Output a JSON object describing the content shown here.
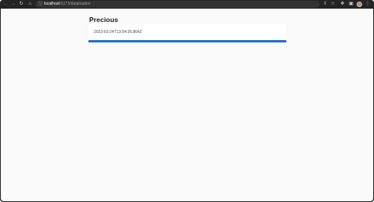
{
  "browser": {
    "url_host": "localhost",
    "url_path": ":5173/dataloader/",
    "icons": {
      "back": "arrow-left-icon",
      "forward": "arrow-right-icon",
      "reload": "reload-icon",
      "home": "home-icon",
      "site_info": "info-icon",
      "share": "share-icon",
      "bookmark": "star-icon",
      "extensions": "puzzle-icon",
      "side_panel": "side-panel-icon",
      "menu": "kebab-menu-icon"
    }
  },
  "page": {
    "title": "Precious",
    "value": "2023-03-24T13:54:35.864Z",
    "progress": 1.0,
    "accent_color": "#1f6fd1"
  }
}
